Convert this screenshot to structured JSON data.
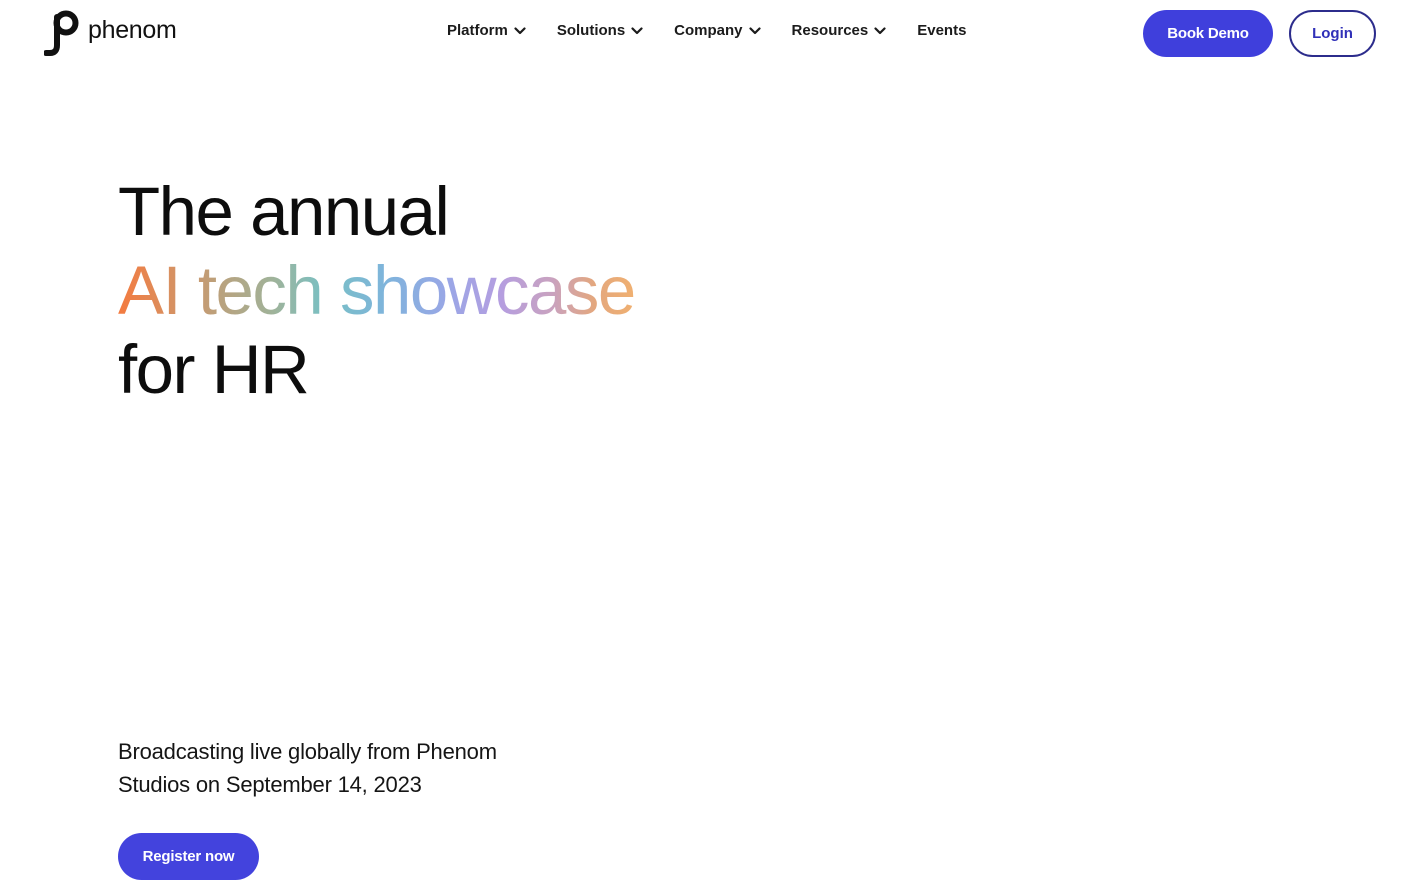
{
  "brand": {
    "logo_text": "phenom",
    "logo_icon": "phenom-logo-icon"
  },
  "nav": {
    "items": [
      {
        "label": "Platform",
        "has_dropdown": true
      },
      {
        "label": "Solutions",
        "has_dropdown": true
      },
      {
        "label": "Company",
        "has_dropdown": true
      },
      {
        "label": "Resources",
        "has_dropdown": true
      },
      {
        "label": "Events",
        "has_dropdown": false
      }
    ]
  },
  "header_actions": {
    "book_demo_label": "Book Demo",
    "login_label": "Login"
  },
  "hero": {
    "title_line1": "The annual",
    "title_line2_part1": "AI",
    "title_line2_part2": "tech",
    "title_line2_part3": "showcase",
    "title_line3": "for HR",
    "subtitle_line1": "Broadcasting live globally from Phenom",
    "subtitle_line2": "Studios on September 14, 2023",
    "cta_label": "Register now"
  },
  "colors": {
    "primary": "#3f3fdc",
    "login_border": "#2c2c8c",
    "text": "#111111",
    "gradient": [
      "#f47a3f",
      "#b9a27e",
      "#79c0c4",
      "#9aa6e6",
      "#c9a2bf",
      "#f0b070"
    ]
  }
}
